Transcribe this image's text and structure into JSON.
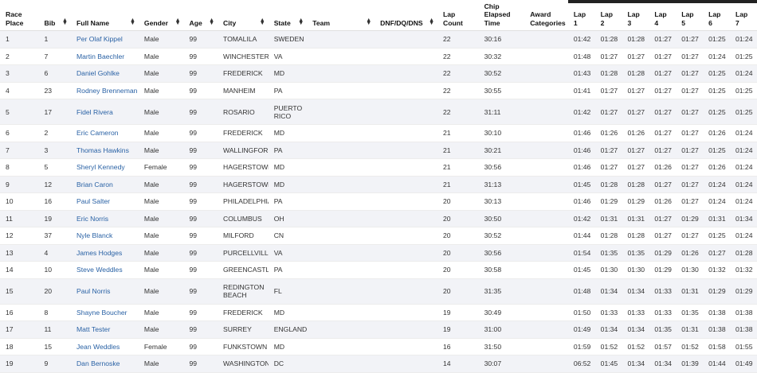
{
  "headers": {
    "place": [
      "Race",
      "Place"
    ],
    "bib": "Bib",
    "name": "Full Name",
    "gender": "Gender",
    "age": "Age",
    "city": "City",
    "state": "State",
    "team": "Team",
    "dnf": "DNF/DQ/DNS",
    "lapcount": [
      "Lap",
      "Count"
    ],
    "chip": [
      "Chip",
      "Elapsed",
      "Time"
    ],
    "award": [
      "Award",
      "Categories"
    ],
    "laps": [
      [
        "Lap",
        "1"
      ],
      [
        "Lap",
        "2"
      ],
      [
        "Lap",
        "3"
      ],
      [
        "Lap",
        "4"
      ],
      [
        "Lap",
        "5"
      ],
      [
        "Lap",
        "6"
      ],
      [
        "Lap",
        "7"
      ]
    ]
  },
  "sort_icon": "sort-arrows-icon",
  "rows": [
    {
      "place": "1",
      "bib": "1",
      "name": "Per Olaf Kippel",
      "gender": "Male",
      "age": "99",
      "city": "TOMALILA",
      "state": "SWEDEN",
      "team": "",
      "dnf": "",
      "lapcount": "22",
      "chip": "30:16",
      "award": "",
      "laps": [
        "01:42",
        "01:28",
        "01:28",
        "01:27",
        "01:27",
        "01:25",
        "01:24"
      ]
    },
    {
      "place": "2",
      "bib": "7",
      "name": "Martin Baechler",
      "gender": "Male",
      "age": "99",
      "city": "WINCHESTER",
      "state": "VA",
      "team": "",
      "dnf": "",
      "lapcount": "22",
      "chip": "30:32",
      "award": "",
      "laps": [
        "01:48",
        "01:27",
        "01:27",
        "01:27",
        "01:27",
        "01:24",
        "01:25"
      ]
    },
    {
      "place": "3",
      "bib": "6",
      "name": "Daniel Gohlke",
      "gender": "Male",
      "age": "99",
      "city": "FREDERICK",
      "state": "MD",
      "team": "",
      "dnf": "",
      "lapcount": "22",
      "chip": "30:52",
      "award": "",
      "laps": [
        "01:43",
        "01:28",
        "01:28",
        "01:27",
        "01:27",
        "01:25",
        "01:24"
      ]
    },
    {
      "place": "4",
      "bib": "23",
      "name": "Rodney Brenneman",
      "gender": "Male",
      "age": "99",
      "city": "MANHEIM",
      "state": "PA",
      "team": "",
      "dnf": "",
      "lapcount": "22",
      "chip": "30:55",
      "award": "",
      "laps": [
        "01:41",
        "01:27",
        "01:27",
        "01:27",
        "01:27",
        "01:25",
        "01:25"
      ]
    },
    {
      "place": "5",
      "bib": "17",
      "name": "Fidel Rivera",
      "gender": "Male",
      "age": "99",
      "city": "ROSARIO",
      "state": "PUERTO RICO",
      "team": "",
      "dnf": "",
      "lapcount": "22",
      "chip": "31:11",
      "award": "",
      "laps": [
        "01:42",
        "01:27",
        "01:27",
        "01:27",
        "01:27",
        "01:25",
        "01:25"
      ]
    },
    {
      "place": "6",
      "bib": "2",
      "name": "Eric Cameron",
      "gender": "Male",
      "age": "99",
      "city": "FREDERICK",
      "state": "MD",
      "team": "",
      "dnf": "",
      "lapcount": "21",
      "chip": "30:10",
      "award": "",
      "laps": [
        "01:46",
        "01:26",
        "01:26",
        "01:27",
        "01:27",
        "01:26",
        "01:24"
      ]
    },
    {
      "place": "7",
      "bib": "3",
      "name": "Thomas Hawkins",
      "gender": "Male",
      "age": "99",
      "city": "WALLINGFORD",
      "state": "PA",
      "team": "",
      "dnf": "",
      "lapcount": "21",
      "chip": "30:21",
      "award": "",
      "laps": [
        "01:46",
        "01:27",
        "01:27",
        "01:27",
        "01:27",
        "01:25",
        "01:24"
      ]
    },
    {
      "place": "8",
      "bib": "5",
      "name": "Sheryl Kennedy",
      "gender": "Female",
      "age": "99",
      "city": "HAGERSTOWN",
      "state": "MD",
      "team": "",
      "dnf": "",
      "lapcount": "21",
      "chip": "30:56",
      "award": "",
      "laps": [
        "01:46",
        "01:27",
        "01:27",
        "01:26",
        "01:27",
        "01:26",
        "01:24"
      ]
    },
    {
      "place": "9",
      "bib": "12",
      "name": "Brian Caron",
      "gender": "Male",
      "age": "99",
      "city": "HAGERSTOWN",
      "state": "MD",
      "team": "",
      "dnf": "",
      "lapcount": "21",
      "chip": "31:13",
      "award": "",
      "laps": [
        "01:45",
        "01:28",
        "01:28",
        "01:27",
        "01:27",
        "01:24",
        "01:24"
      ]
    },
    {
      "place": "10",
      "bib": "16",
      "name": "Paul Salter",
      "gender": "Male",
      "age": "99",
      "city": "PHILADELPHIA",
      "state": "PA",
      "team": "",
      "dnf": "",
      "lapcount": "20",
      "chip": "30:13",
      "award": "",
      "laps": [
        "01:46",
        "01:29",
        "01:29",
        "01:26",
        "01:27",
        "01:24",
        "01:24"
      ]
    },
    {
      "place": "11",
      "bib": "19",
      "name": "Eric Norris",
      "gender": "Male",
      "age": "99",
      "city": "COLUMBUS",
      "state": "OH",
      "team": "",
      "dnf": "",
      "lapcount": "20",
      "chip": "30:50",
      "award": "",
      "laps": [
        "01:42",
        "01:31",
        "01:31",
        "01:27",
        "01:29",
        "01:31",
        "01:34"
      ]
    },
    {
      "place": "12",
      "bib": "37",
      "name": "Nyle Blanck",
      "gender": "Male",
      "age": "99",
      "city": "MILFORD",
      "state": "CN",
      "team": "",
      "dnf": "",
      "lapcount": "20",
      "chip": "30:52",
      "award": "",
      "laps": [
        "01:44",
        "01:28",
        "01:28",
        "01:27",
        "01:27",
        "01:25",
        "01:24"
      ]
    },
    {
      "place": "13",
      "bib": "4",
      "name": "James Hodges",
      "gender": "Male",
      "age": "99",
      "city": "PURCELLVILLE",
      "state": "VA",
      "team": "",
      "dnf": "",
      "lapcount": "20",
      "chip": "30:56",
      "award": "",
      "laps": [
        "01:54",
        "01:35",
        "01:35",
        "01:29",
        "01:26",
        "01:27",
        "01:28"
      ]
    },
    {
      "place": "14",
      "bib": "10",
      "name": "Steve Weddles",
      "gender": "Male",
      "age": "99",
      "city": "GREENCASTLE",
      "state": "PA",
      "team": "",
      "dnf": "",
      "lapcount": "20",
      "chip": "30:58",
      "award": "",
      "laps": [
        "01:45",
        "01:30",
        "01:30",
        "01:29",
        "01:30",
        "01:32",
        "01:32"
      ]
    },
    {
      "place": "15",
      "bib": "20",
      "name": "Paul Norris",
      "gender": "Male",
      "age": "99",
      "city": "REDINGTON BEACH",
      "state": "FL",
      "team": "",
      "dnf": "",
      "lapcount": "20",
      "chip": "31:35",
      "award": "",
      "laps": [
        "01:48",
        "01:34",
        "01:34",
        "01:33",
        "01:31",
        "01:29",
        "01:29"
      ]
    },
    {
      "place": "16",
      "bib": "8",
      "name": "Shayne Boucher",
      "gender": "Male",
      "age": "99",
      "city": "FREDERICK",
      "state": "MD",
      "team": "",
      "dnf": "",
      "lapcount": "19",
      "chip": "30:49",
      "award": "",
      "laps": [
        "01:50",
        "01:33",
        "01:33",
        "01:33",
        "01:35",
        "01:38",
        "01:38"
      ]
    },
    {
      "place": "17",
      "bib": "11",
      "name": "Matt Tester",
      "gender": "Male",
      "age": "99",
      "city": "SURREY",
      "state": "ENGLAND",
      "team": "",
      "dnf": "",
      "lapcount": "19",
      "chip": "31:00",
      "award": "",
      "laps": [
        "01:49",
        "01:34",
        "01:34",
        "01:35",
        "01:31",
        "01:38",
        "01:38"
      ]
    },
    {
      "place": "18",
      "bib": "15",
      "name": "Jean Weddles",
      "gender": "Female",
      "age": "99",
      "city": "FUNKSTOWN",
      "state": "MD",
      "team": "",
      "dnf": "",
      "lapcount": "16",
      "chip": "31:50",
      "award": "",
      "laps": [
        "01:59",
        "01:52",
        "01:52",
        "01:57",
        "01:52",
        "01:58",
        "01:55"
      ]
    },
    {
      "place": "19",
      "bib": "9",
      "name": "Dan Bernoske",
      "gender": "Male",
      "age": "99",
      "city": "WASHINGTON",
      "state": "DC",
      "team": "",
      "dnf": "",
      "lapcount": "14",
      "chip": "30:07",
      "award": "",
      "laps": [
        "06:52",
        "01:45",
        "01:34",
        "01:34",
        "01:39",
        "01:44",
        "01:49"
      ]
    }
  ]
}
